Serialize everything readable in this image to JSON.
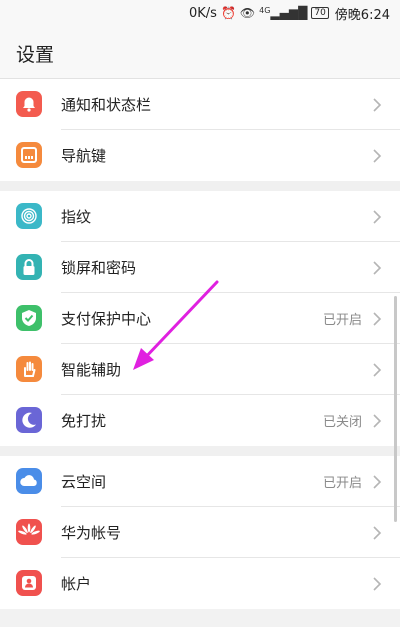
{
  "status_bar": {
    "speed": "0K/s",
    "network": "4G",
    "battery": "70",
    "time": "傍晚6:24"
  },
  "header": {
    "title": "设置"
  },
  "groups": [
    [
      {
        "label": "通知和状态栏",
        "value": "",
        "icon": "bell-icon",
        "color": "#f35b4f"
      },
      {
        "label": "导航键",
        "value": "",
        "icon": "navigation-key-icon",
        "color": "#f58a3d"
      }
    ],
    [
      {
        "label": "指纹",
        "value": "",
        "icon": "fingerprint-icon",
        "color": "#3bb8c8"
      },
      {
        "label": "锁屏和密码",
        "value": "",
        "icon": "lock-icon",
        "color": "#33b3b3"
      },
      {
        "label": "支付保护中心",
        "value": "已开启",
        "icon": "shield-check-icon",
        "color": "#3ec06a"
      },
      {
        "label": "智能辅助",
        "value": "",
        "icon": "hand-icon",
        "color": "#f58a3d"
      },
      {
        "label": "免打扰",
        "value": "已关闭",
        "icon": "moon-icon",
        "color": "#6a66d6"
      }
    ],
    [
      {
        "label": "云空间",
        "value": "已开启",
        "icon": "cloud-icon",
        "color": "#4a8de8"
      },
      {
        "label": "华为帐号",
        "value": "",
        "icon": "huawei-logo-icon",
        "color": "#f0514e"
      },
      {
        "label": "帐户",
        "value": "",
        "icon": "account-icon",
        "color": "#f0514e"
      }
    ]
  ],
  "annotation": {
    "color": "#e020e0",
    "target": "智能辅助"
  }
}
